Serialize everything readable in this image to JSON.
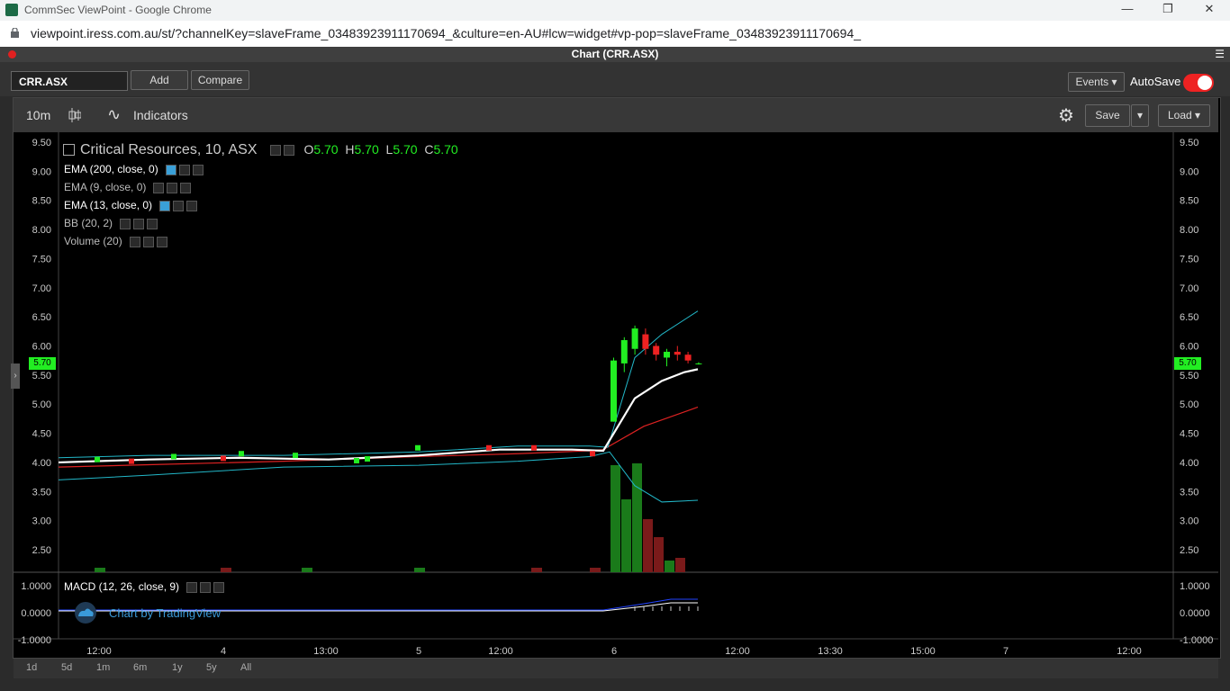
{
  "browser": {
    "window_title": "CommSec ViewPoint - Google Chrome",
    "url": "viewpoint.iress.com.au/st/?channelKey=slaveFrame_03483923911170694_&culture=en-AU#lcw=widget#vp-pop=slaveFrame_03483923911170694_",
    "minimize": "—",
    "restore": "❐",
    "close": "✕"
  },
  "frame": {
    "title": "Chart (CRR.ASX)",
    "menu_icon": "☰"
  },
  "toolbar": {
    "symbol": "CRR.ASX",
    "add": "Add",
    "compare": "Compare",
    "events": "Events ▾",
    "autosave": "AutoSave"
  },
  "chart_toolbar": {
    "interval": "10m",
    "indicators": "Indicators",
    "save": "Save",
    "save_dropdown": "▾",
    "load": "Load ▾",
    "indicators_icon": "∿",
    "settings_icon": "⚙"
  },
  "legend": {
    "title": "Critical Resources, 10, ASX",
    "o_label": "O",
    "o": "5.70",
    "h_label": "H",
    "h": "5.70",
    "l_label": "L",
    "l": "5.70",
    "c_label": "C",
    "c": "5.70",
    "studies": [
      "EMA (200, close, 0)",
      "EMA (9, close, 0)",
      "EMA (13, close, 0)",
      "BB (20, 2)",
      "Volume (20)"
    ],
    "macd": "MACD (12, 26, close, 9)",
    "watermark": "Chart by TradingView"
  },
  "price_tag": "5.70",
  "bottom_ranges": [
    "1d",
    "5d",
    "1m",
    "6m",
    "1y",
    "5y",
    "All"
  ],
  "chart_data": {
    "type": "candlestick",
    "title": "Critical Resources, 10, ASX",
    "y_ticks": [
      "9.50",
      "9.00",
      "8.50",
      "8.00",
      "7.50",
      "7.00",
      "6.50",
      "6.00",
      "5.50",
      "5.00",
      "4.50",
      "4.00",
      "3.50",
      "3.00",
      "2.50"
    ],
    "macd_ticks": [
      "1.0000",
      "0.0000",
      "-1.0000"
    ],
    "x_ticks": [
      "12:00",
      "4",
      "13:00",
      "5",
      "12:00",
      "6",
      "12:00",
      "13:30",
      "15:00",
      "7",
      "12:00"
    ],
    "ylim": [
      2.25,
      9.6
    ],
    "last_close": 5.7,
    "candles_day6": [
      {
        "o": 4.7,
        "h": 5.8,
        "l": 4.7,
        "c": 5.75
      },
      {
        "o": 5.7,
        "h": 6.15,
        "l": 5.55,
        "c": 6.1
      },
      {
        "o": 5.95,
        "h": 6.35,
        "l": 5.85,
        "c": 6.3
      },
      {
        "o": 6.2,
        "h": 6.3,
        "l": 5.85,
        "c": 5.95
      },
      {
        "o": 6.0,
        "h": 6.05,
        "l": 5.75,
        "c": 5.85
      },
      {
        "o": 5.8,
        "h": 5.95,
        "l": 5.65,
        "c": 5.9
      },
      {
        "o": 5.9,
        "h": 6.0,
        "l": 5.75,
        "c": 5.85
      },
      {
        "o": 5.85,
        "h": 5.9,
        "l": 5.7,
        "c": 5.75
      },
      {
        "o": 5.7,
        "h": 5.72,
        "l": 5.68,
        "c": 5.7
      }
    ]
  },
  "colors": {
    "up": "#22ee22",
    "down": "#ee2222",
    "ema_white": "#ffffff",
    "ema_red": "#dd2222",
    "bb": "#22b7c8",
    "macd": "#2244ff"
  }
}
